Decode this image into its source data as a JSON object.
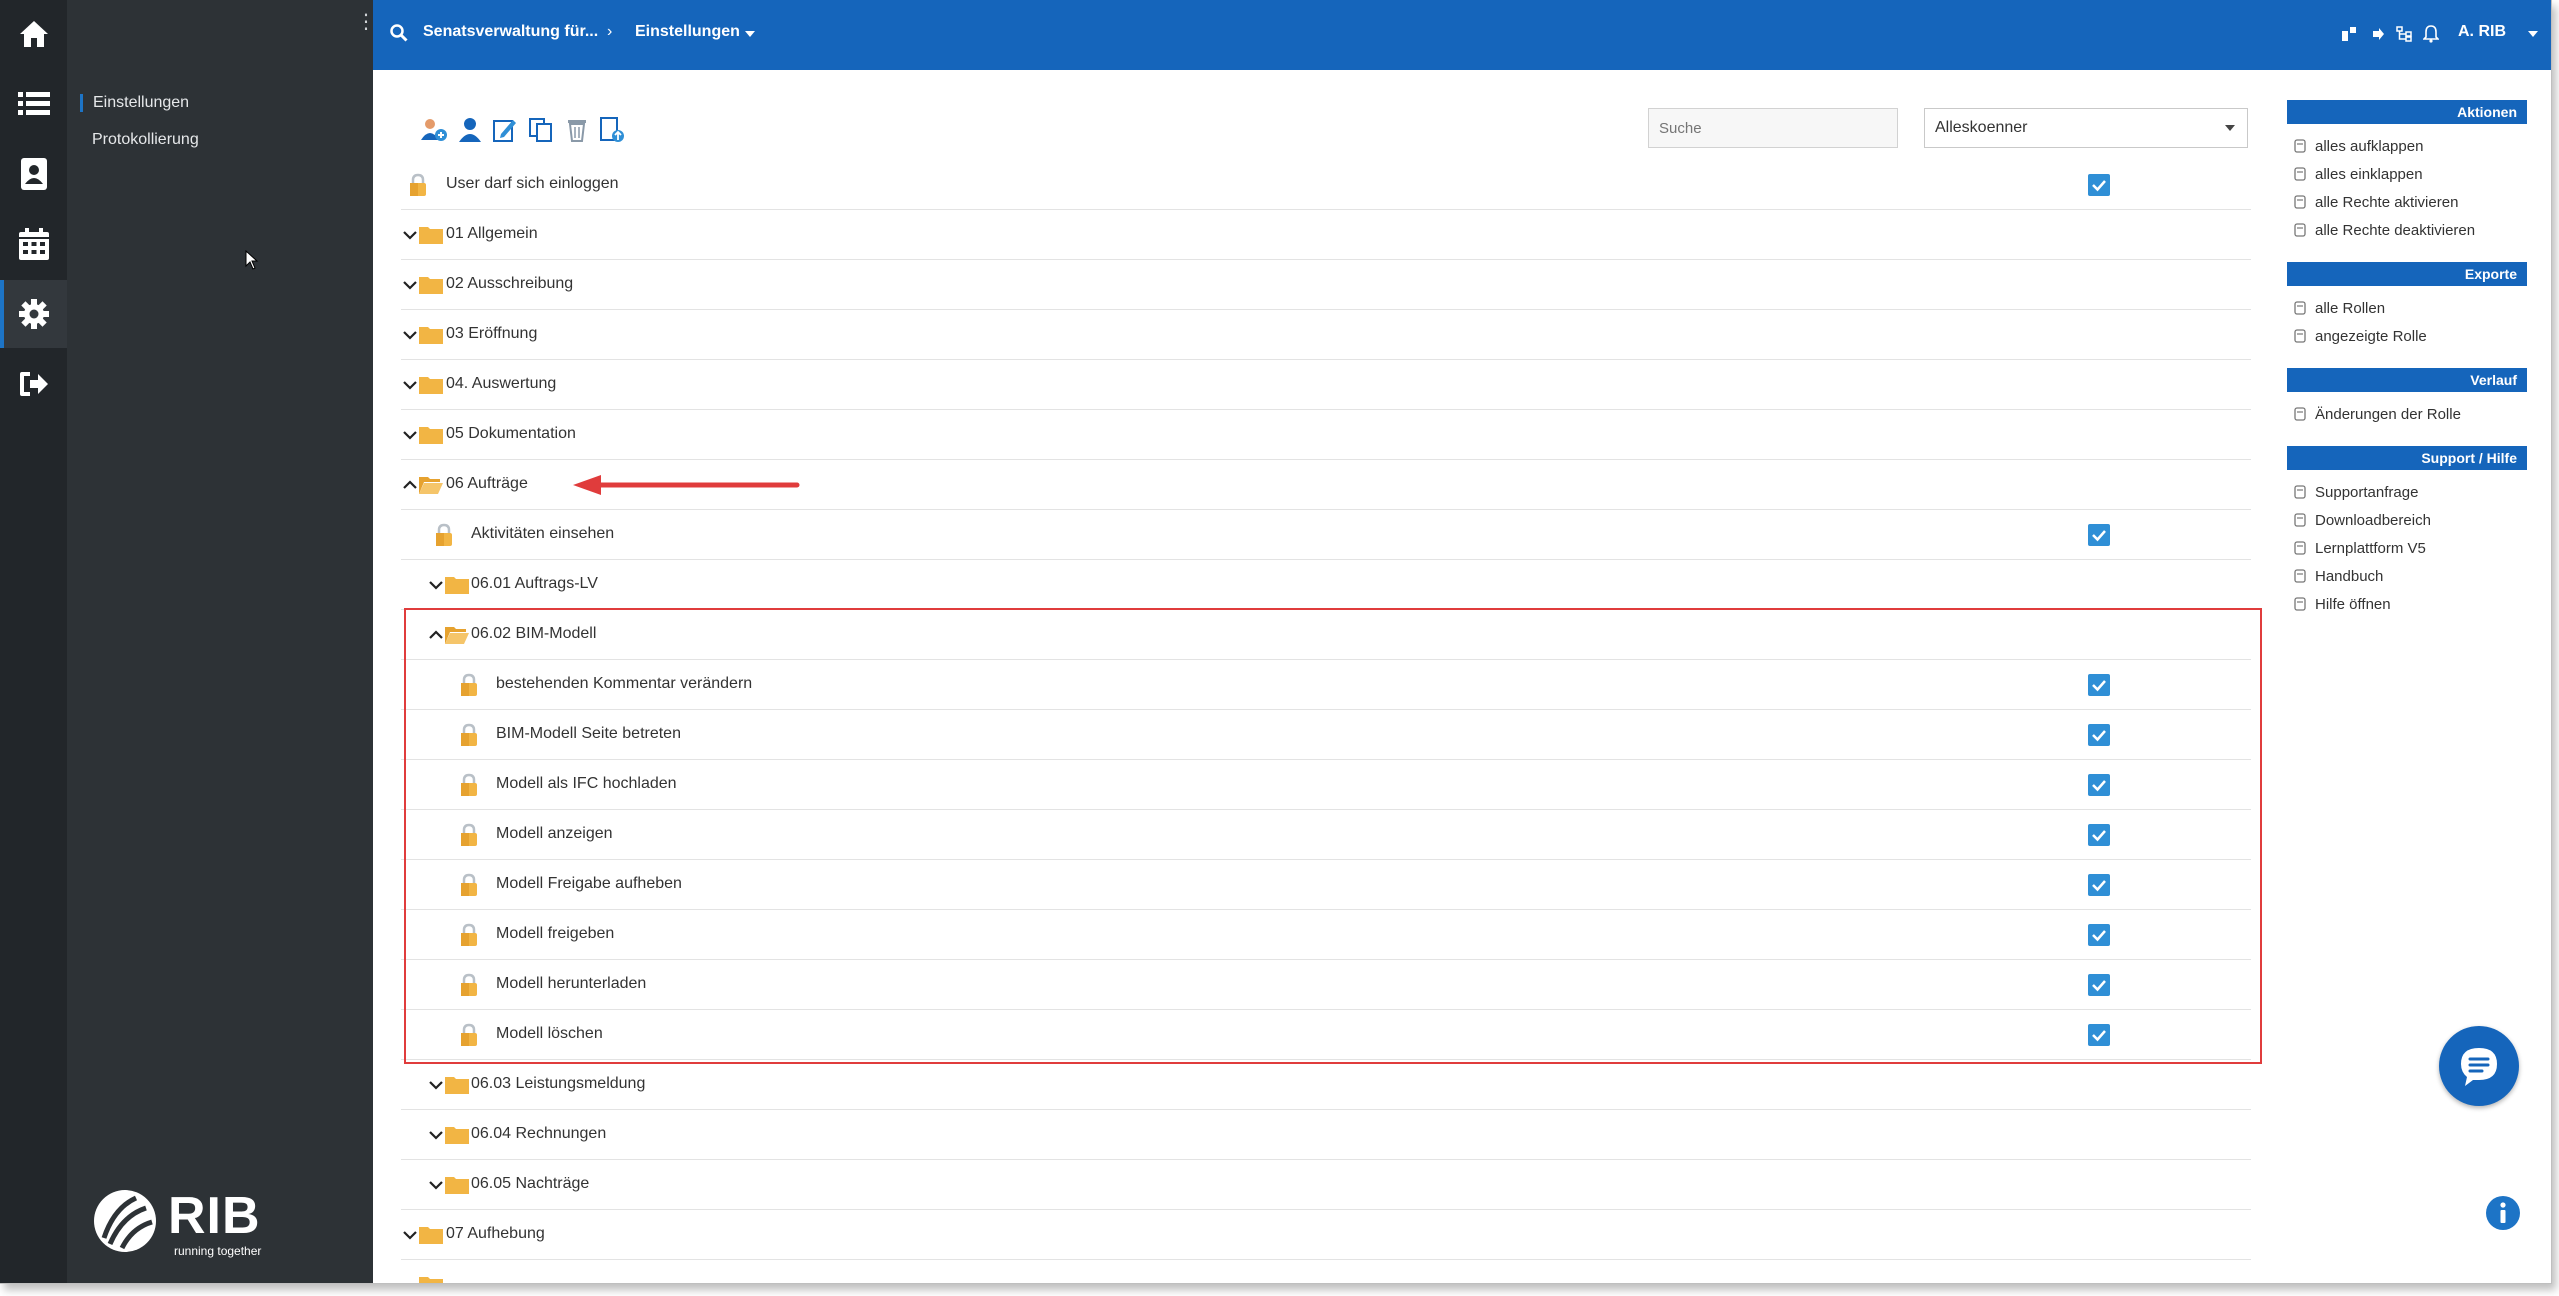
{
  "colors": {
    "accent": "#1565bb",
    "rail": "#22262a",
    "panel": "#2d3236",
    "folder": "#f2b544",
    "checkbox": "#2f8fd6",
    "highlight": "#e03c3c",
    "arrow": "#e03c3c"
  },
  "rail": {
    "icons": [
      "home-icon",
      "list-icon",
      "contacts-icon",
      "calendar-icon",
      "gear-icon",
      "logout-icon"
    ]
  },
  "panel": {
    "items": [
      {
        "label": "Einstellungen",
        "active": true
      },
      {
        "label": "Protokollierung",
        "active": false
      }
    ],
    "logo_text": "RIB",
    "logo_tagline": "running together"
  },
  "topbar": {
    "breadcrumb_1": "Senatsverwaltung für...",
    "breadcrumb_2": "Einstellungen",
    "user": "A. RIB"
  },
  "toolbar": {
    "icons": [
      "add-user-icon",
      "user-icon",
      "edit-icon",
      "copy-icon",
      "delete-icon",
      "export-icon"
    ]
  },
  "search": {
    "placeholder": "Suche"
  },
  "role_select": {
    "value": "Alleskoenner"
  },
  "tree": [
    {
      "label": "User darf sich einloggen",
      "type": "right",
      "level": 0,
      "checked": true
    },
    {
      "label": "01 Allgemein",
      "type": "folder",
      "level": 0,
      "open": false
    },
    {
      "label": "02 Ausschreibung",
      "type": "folder",
      "level": 0,
      "open": false
    },
    {
      "label": "03 Eröffnung",
      "type": "folder",
      "level": 0,
      "open": false
    },
    {
      "label": "04. Auswertung",
      "type": "folder",
      "level": 0,
      "open": false
    },
    {
      "label": "05 Dokumentation",
      "type": "folder",
      "level": 0,
      "open": false
    },
    {
      "label": "06 Aufträge",
      "type": "folder",
      "level": 0,
      "open": true
    },
    {
      "label": "Aktivitäten einsehen",
      "type": "right",
      "level": 1,
      "checked": true
    },
    {
      "label": "06.01 Auftrags-LV",
      "type": "folder",
      "level": 1,
      "open": false
    },
    {
      "label": "06.02 BIM-Modell",
      "type": "folder",
      "level": 1,
      "open": true
    },
    {
      "label": "bestehenden Kommentar verändern",
      "type": "right",
      "level": 2,
      "checked": true
    },
    {
      "label": "BIM-Modell Seite betreten",
      "type": "right",
      "level": 2,
      "checked": true
    },
    {
      "label": "Modell als IFC hochladen",
      "type": "right",
      "level": 2,
      "checked": true
    },
    {
      "label": "Modell anzeigen",
      "type": "right",
      "level": 2,
      "checked": true
    },
    {
      "label": "Modell Freigabe aufheben",
      "type": "right",
      "level": 2,
      "checked": true
    },
    {
      "label": "Modell freigeben",
      "type": "right",
      "level": 2,
      "checked": true
    },
    {
      "label": "Modell herunterladen",
      "type": "right",
      "level": 2,
      "checked": true
    },
    {
      "label": "Modell löschen",
      "type": "right",
      "level": 2,
      "checked": true
    },
    {
      "label": "06.03 Leistungsmeldung",
      "type": "folder",
      "level": 1,
      "open": false
    },
    {
      "label": "06.04 Rechnungen",
      "type": "folder",
      "level": 1,
      "open": false
    },
    {
      "label": "06.05 Nachträge",
      "type": "folder",
      "level": 1,
      "open": false
    },
    {
      "label": "07 Aufhebung",
      "type": "folder",
      "level": 0,
      "open": false
    }
  ],
  "sidebar_right": [
    {
      "title": "Aktionen",
      "items": [
        "alles aufklappen",
        "alles einklappen",
        "alle Rechte aktivieren",
        "alle Rechte deaktivieren"
      ]
    },
    {
      "title": "Exporte",
      "items": [
        "alle Rollen",
        "angezeigte Rolle"
      ]
    },
    {
      "title": "Verlauf",
      "items": [
        "Änderungen der Rolle"
      ]
    },
    {
      "title": "Support / Hilfe",
      "items": [
        "Supportanfrage",
        "Downloadbereich",
        "Lernplattform V5",
        "Handbuch",
        "Hilfe öffnen"
      ]
    }
  ]
}
